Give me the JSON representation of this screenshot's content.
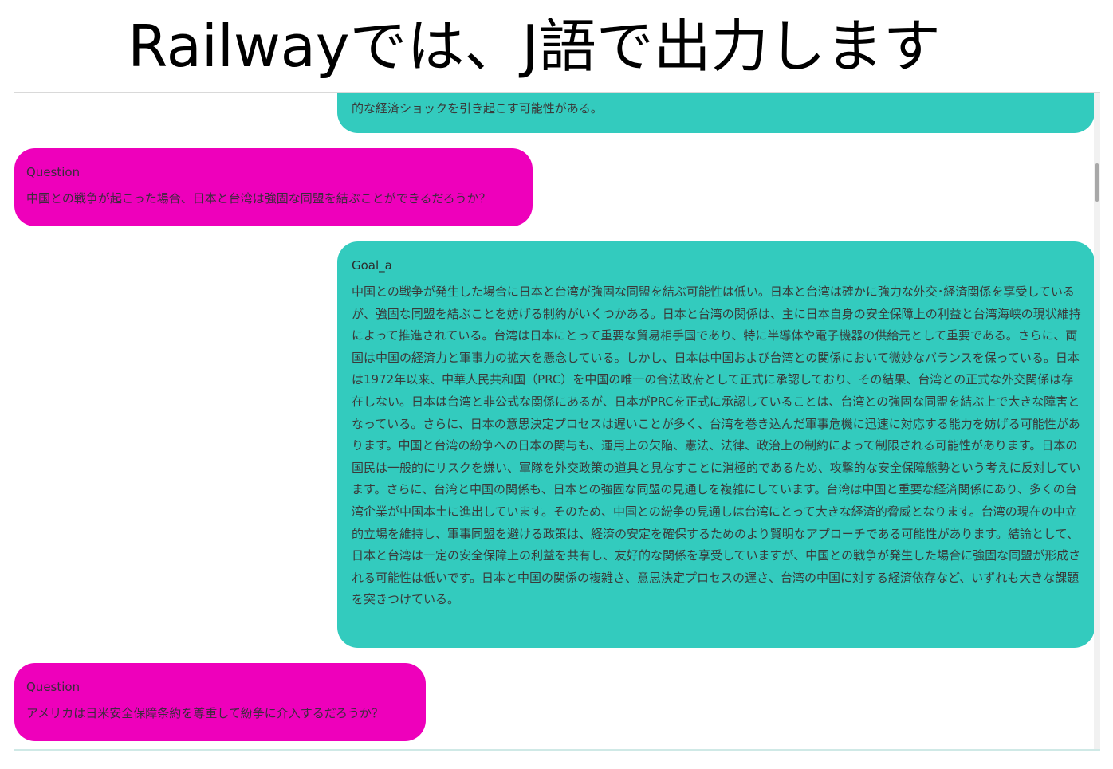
{
  "slide": {
    "title": "Railwayでは、J語で出力します"
  },
  "chat": {
    "messages": [
      {
        "sender": "",
        "text": "的な経済ショックを引き起こす可能性がある。"
      },
      {
        "sender": "Question",
        "text": "中国との戦争が起こった場合、日本と台湾は強固な同盟を結ぶことができるだろうか？"
      },
      {
        "sender": "Goal_a",
        "text": "中国との戦争が発生した場合に日本と台湾が強固な同盟を結ぶ可能性は低い。日本と台湾は確かに強力な外交･経済関係を享受しているが、強固な同盟を結ぶことを妨げる制約がいくつかある。日本と台湾の関係は、主に日本自身の安全保障上の利益と台湾海峡の現状維持によって推進されている。台湾は日本にとって重要な貿易相手国であり、特に半導体や電子機器の供給元として重要である。さらに、両国は中国の経済力と軍事力の拡大を懸念している。しかし、日本は中国および台湾との関係において微妙なバランスを保っている。日本は1972年以来、中華人民共和国（PRC）を中国の唯一の合法政府として正式に承認しており、その結果、台湾との正式な外交関係は存在しない。日本は台湾と非公式な関係にあるが、日本がPRCを正式に承認していることは、台湾との強固な同盟を結ぶ上で大きな障害となっている。さらに、日本の意思決定プロセスは遅いことが多く、台湾を巻き込んだ軍事危機に迅速に対応する能力を妨げる可能性があります。中国と台湾の紛争への日本の関与も、運用上の欠陥、憲法、法律、政治上の制約によって制限される可能性があります。日本の国民は一般的にリスクを嫌い、軍隊を外交政策の道具と見なすことに消極的であるため、攻撃的な安全保障態勢という考えに反対しています。さらに、台湾と中国の関係も、日本との強固な同盟の見通しを複雑にしています。台湾は中国と重要な経済関係にあり、多くの台湾企業が中国本土に進出しています。そのため、中国との紛争の見通しは台湾にとって大きな経済的脅威となります。台湾の現在の中立的立場を維持し、軍事同盟を避ける政策は、経済の安定を確保するためのより賢明なアプローチである可能性があります。結論として、日本と台湾は一定の安全保障上の利益を共有し、友好的な関係を享受していますが、中国との戦争が発生した場合に強固な同盟が形成される可能性は低いです。日本と中国の関係の複雑さ、意思決定プロセスの遅さ、台湾の中国に対する経済依存など、いずれも大きな課題を突きつけている。"
      },
      {
        "sender": "Question",
        "text": "アメリカは日米安全保障条約を尊重して紛争に介入するだろうか？"
      }
    ]
  },
  "colors": {
    "answer_bubble": "#33cbbe",
    "question_bubble": "#ee00bb",
    "title_text": "#000000"
  }
}
